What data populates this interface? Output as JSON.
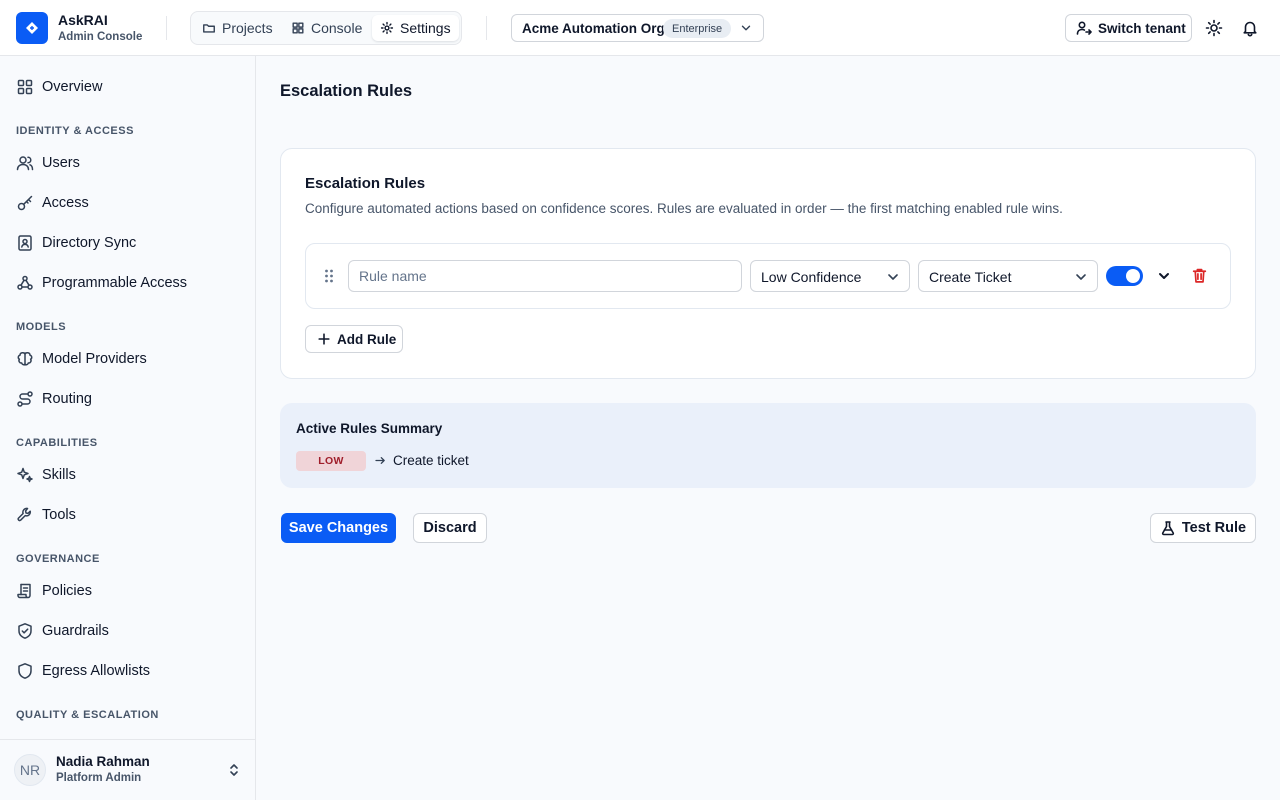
{
  "brand": {
    "name": "AskRAI",
    "subtitle": "Admin Console"
  },
  "nav": {
    "tabs": [
      {
        "label": "Projects",
        "icon": "folder-icon"
      },
      {
        "label": "Console",
        "icon": "grid-icon"
      },
      {
        "label": "Settings",
        "icon": "gear-icon",
        "active": true
      }
    ]
  },
  "org": {
    "name": "Acme Automation Org",
    "plan": "Enterprise"
  },
  "header": {
    "switch_tenant_label": "Switch tenant"
  },
  "sidebar": {
    "overview": "Overview",
    "sections": [
      {
        "title": "IDENTITY & ACCESS",
        "items": [
          "Users",
          "Access",
          "Directory Sync",
          "Programmable Access"
        ]
      },
      {
        "title": "MODELS",
        "items": [
          "Model Providers",
          "Routing"
        ]
      },
      {
        "title": "CAPABILITIES",
        "items": [
          "Skills",
          "Tools"
        ]
      },
      {
        "title": "GOVERNANCE",
        "items": [
          "Policies",
          "Guardrails",
          "Egress Allowlists"
        ]
      },
      {
        "title": "QUALITY & ESCALATION",
        "items": []
      }
    ]
  },
  "user": {
    "initials": "NR",
    "name": "Nadia Rahman",
    "role": "Platform Admin"
  },
  "page": {
    "title": "Escalation Rules"
  },
  "card": {
    "title": "Escalation Rules",
    "description": "Configure automated actions based on confidence scores. Rules are evaluated in order — the first matching enabled rule wins.",
    "rule": {
      "name_value": "",
      "name_placeholder": "Rule name",
      "condition": "Low Confidence",
      "action": "Create Ticket",
      "enabled": true
    },
    "add_rule_label": "Add Rule"
  },
  "summary": {
    "title": "Active Rules Summary",
    "badge": "LOW",
    "action": "Create ticket"
  },
  "footer": {
    "save_label": "Save Changes",
    "discard_label": "Discard",
    "test_label": "Test Rule"
  },
  "colors": {
    "accent": "#0a5cf5",
    "danger": "#dc2626",
    "badge_bg": "#f0d4d8",
    "summary_bg": "#eaf0fa"
  }
}
